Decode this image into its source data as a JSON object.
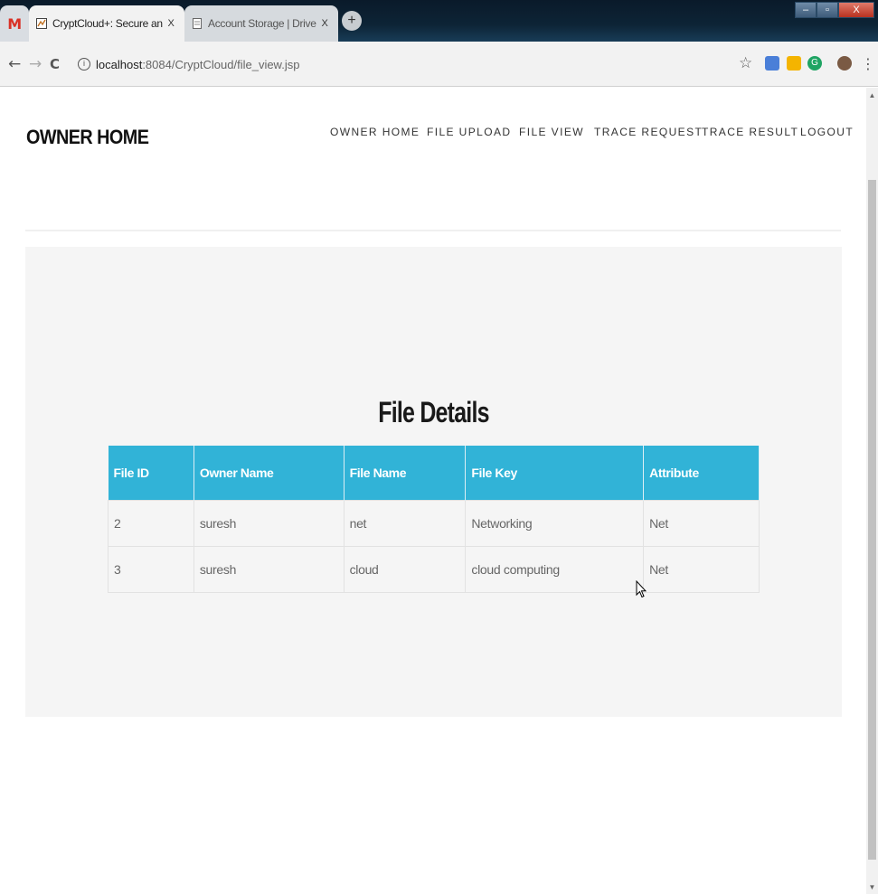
{
  "browser": {
    "tabs": [
      {
        "title": "",
        "icon": "gmail-icon",
        "active": false
      },
      {
        "title": "CryptCloud+: Secure and Expres",
        "icon": "favicon-icon",
        "active": true
      },
      {
        "title": "Account Storage | DriveHQ",
        "icon": "page-icon",
        "active": false
      }
    ],
    "gmail_letter": "M",
    "tab_close": "X",
    "new_tab": "+",
    "window_controls": {
      "minimize": "–",
      "restore": "▫",
      "close": "X"
    },
    "nav": {
      "back": "←",
      "forward": "→",
      "reload": "C"
    },
    "url_host": "localhost",
    "url_path": ":8084/CryptCloud/file_view.jsp",
    "info": "i",
    "bookmark": "☆",
    "menu": "⋮",
    "ext_g": "G"
  },
  "site": {
    "brand": "OWNER HOME",
    "menu": [
      "OWNER HOME",
      "FILE UPLOAD",
      "FILE VIEW",
      "TRACE REQUEST",
      "TRACE RESULT",
      "LOGOUT"
    ]
  },
  "main": {
    "title": "File Details",
    "table": {
      "headers": [
        "File ID",
        "Owner Name",
        "File Name",
        "File Key",
        "Attribute"
      ],
      "rows": [
        [
          "2",
          "suresh",
          "net",
          "Networking",
          "Net"
        ],
        [
          "3",
          "suresh",
          "cloud",
          "cloud computing",
          "Net"
        ]
      ]
    }
  },
  "colors": {
    "table_header": "#31b3d7",
    "panel_bg": "#f5f5f5",
    "gmail_red": "#d93025",
    "ext_green": "#1fa463"
  }
}
